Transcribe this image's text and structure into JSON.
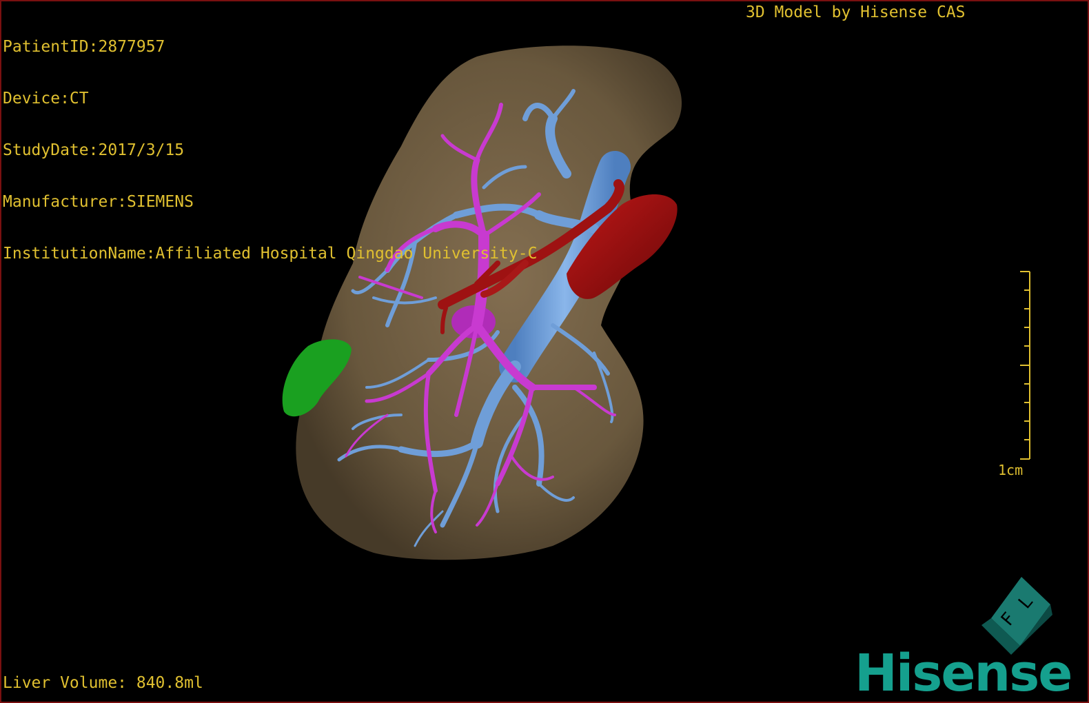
{
  "overlay": {
    "patient_id": "PatientID:2877957",
    "device": "Device:CT",
    "study_date": "StudyDate:2017/3/15",
    "manufacturer": "Manufacturer:SIEMENS",
    "institution": "InstitutionName:Affiliated Hospital Qingdao University-C",
    "credit": "3D Model by Hisense CAS",
    "liver_volume": "Liver Volume: 840.8ml"
  },
  "scale_bar": {
    "label": "1cm"
  },
  "orientation_cube": {
    "letters": [
      "F",
      "L"
    ]
  },
  "brand": {
    "logo_text": "Hisense",
    "logo_color": "#15a08e"
  },
  "colors": {
    "text": "#e0c030",
    "liver": "#7a6545",
    "portal_vein": "#6f9ed8",
    "hepatic_vein": "#c83ad0",
    "artery": "#9e1212",
    "lesion": "#1aa020",
    "frame": "#7a1010"
  },
  "icons": [
    "orientation-cube-icon",
    "scale-bar-icon"
  ]
}
